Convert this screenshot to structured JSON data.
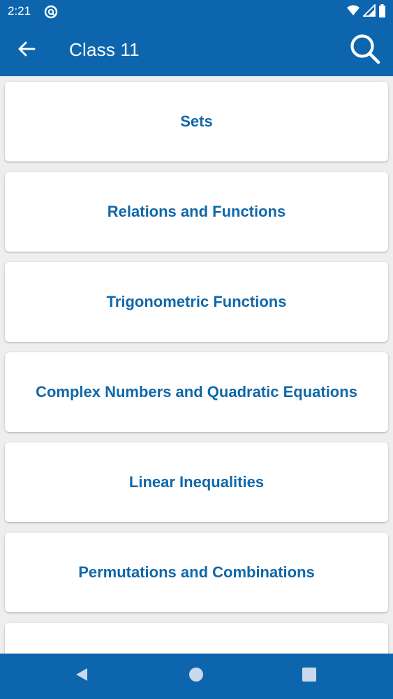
{
  "status_bar": {
    "time": "2:21",
    "icons": [
      "app-notification-icon",
      "wifi-icon",
      "signal-icon",
      "battery-icon"
    ]
  },
  "app_bar": {
    "title": "Class 11",
    "back_icon": "arrow-back-icon",
    "search_icon": "search-icon"
  },
  "chapters": [
    {
      "label": "Sets"
    },
    {
      "label": "Relations and Functions"
    },
    {
      "label": "Trigonometric Functions"
    },
    {
      "label": "Complex Numbers and Quadratic Equations"
    },
    {
      "label": "Linear Inequalities"
    },
    {
      "label": "Permutations and Combinations"
    },
    {
      "label": ""
    }
  ],
  "nav_bar": {
    "icons": [
      "nav-back-icon",
      "nav-home-icon",
      "nav-recents-icon"
    ]
  },
  "colors": {
    "primary": "#0d66ad",
    "card_text": "#1068a9",
    "background": "#eeeeee",
    "card": "#ffffff"
  }
}
